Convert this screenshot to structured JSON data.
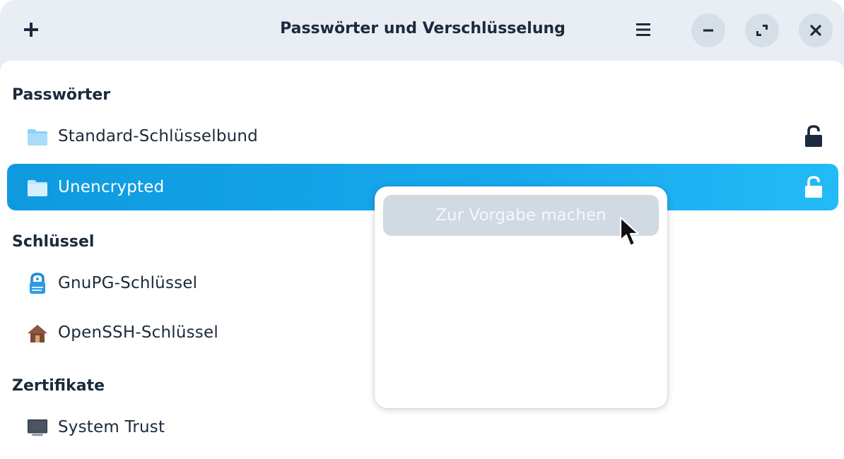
{
  "window": {
    "title": "Passwörter und Verschlüsselung"
  },
  "header": {
    "add_icon": "plus-icon",
    "menu_icon": "hamburger-menu-icon",
    "minimize_icon": "minimize-icon",
    "maximize_icon": "maximize-icon",
    "close_icon": "close-icon"
  },
  "sections": [
    {
      "header": "Passwörter",
      "items": [
        {
          "label": "Standard-Schlüsselbund",
          "icon": "folder-icon",
          "status_icon": "unlocked-padlock-icon",
          "selected": false
        },
        {
          "label": "Unencrypted",
          "icon": "folder-icon",
          "status_icon": "unlocked-padlock-icon",
          "selected": true
        }
      ]
    },
    {
      "header": "Schlüssel",
      "items": [
        {
          "label": "GnuPG-Schlüssel",
          "icon": "gnupg-key-icon"
        },
        {
          "label": "OpenSSH-Schlüssel",
          "icon": "house-icon"
        }
      ]
    },
    {
      "header": "Zertifikate",
      "items": [
        {
          "label": "System Trust",
          "icon": "monitor-icon"
        }
      ]
    }
  ],
  "context_menu": {
    "items": [
      {
        "label": "Zur Vorgabe machen",
        "enabled": false
      }
    ]
  },
  "colors": {
    "accent": "#1aa6ea",
    "header_bg": "#e9eef5",
    "text": "#1b2a3c"
  }
}
